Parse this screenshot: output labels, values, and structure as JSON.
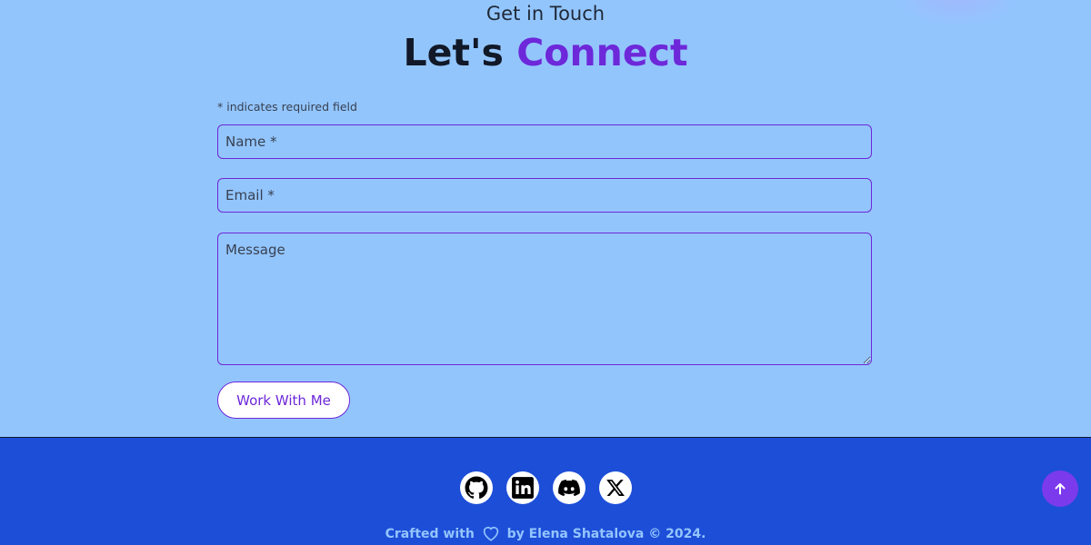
{
  "contact": {
    "eyebrow": "Get in Touch",
    "headline_lead": "Let's",
    "headline_accent": "Connect",
    "required_note": "* indicates required field",
    "fields": {
      "name_placeholder": "Name *",
      "email_placeholder": "Email *",
      "message_placeholder": "Message"
    },
    "submit_label": "Work With Me"
  },
  "footer": {
    "social_icons": [
      "github-icon",
      "linkedin-icon",
      "discord-icon",
      "x-icon"
    ],
    "credit_prefix": "Crafted with",
    "credit_suffix": "by Elena Shatalova © 2024."
  },
  "scroll_top_icon": "arrow-up-icon",
  "colors": {
    "page_background": "#93c5fd",
    "accent": "#6d28d9",
    "footer_background": "#1d4ed8",
    "scroll_button": "#7c3aed",
    "credit_text": "#93c5fd"
  }
}
